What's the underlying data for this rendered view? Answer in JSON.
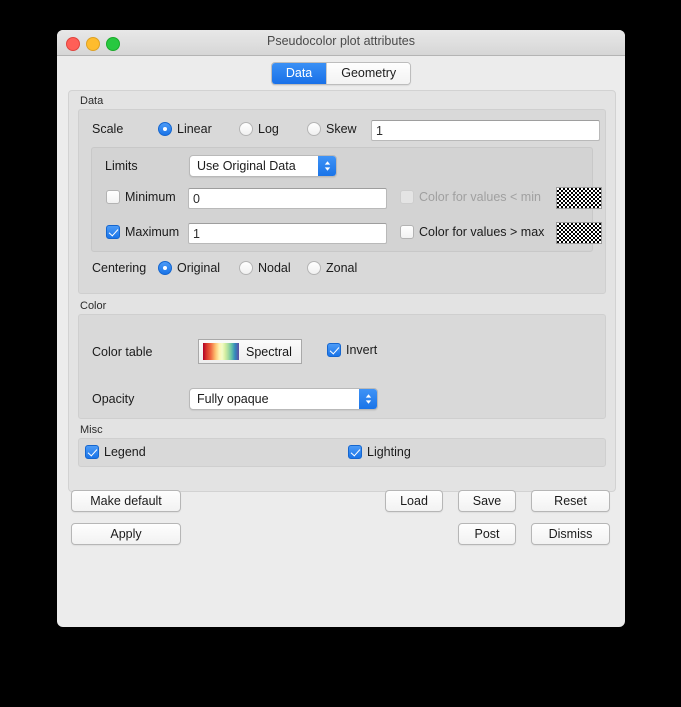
{
  "window": {
    "title": "Pseudocolor plot attributes",
    "controls": {
      "close": "close-button",
      "minimize": "minimize-button",
      "maximize": "maximize-button"
    }
  },
  "tabs": [
    {
      "label": "Data",
      "active": true
    },
    {
      "label": "Geometry",
      "active": false
    }
  ],
  "data_group": {
    "title": "Data",
    "scale": {
      "label": "Scale",
      "options": [
        {
          "label": "Linear",
          "selected": true
        },
        {
          "label": "Log",
          "selected": false
        },
        {
          "label": "Skew",
          "selected": false
        }
      ],
      "skew_value": "1"
    },
    "limits": {
      "label": "Limits",
      "selected": "Use Original Data",
      "minimum": {
        "label": "Minimum",
        "checked": false,
        "value": "0"
      },
      "maximum": {
        "label": "Maximum",
        "checked": true,
        "value": "1"
      },
      "color_below_min": {
        "label": "Color for values < min",
        "checked": false,
        "enabled": false
      },
      "color_above_max": {
        "label": "Color for values > max",
        "checked": false,
        "enabled": true
      }
    },
    "centering": {
      "label": "Centering",
      "options": [
        {
          "label": "Original",
          "selected": true
        },
        {
          "label": "Nodal",
          "selected": false
        },
        {
          "label": "Zonal",
          "selected": false
        }
      ]
    }
  },
  "color_group": {
    "title": "Color",
    "color_table": {
      "label": "Color table",
      "value": "Spectral",
      "invert": {
        "label": "Invert",
        "checked": true
      }
    },
    "opacity": {
      "label": "Opacity",
      "selected": "Fully opaque"
    }
  },
  "misc_group": {
    "title": "Misc",
    "legend": {
      "label": "Legend",
      "checked": true
    },
    "lighting": {
      "label": "Lighting",
      "checked": true
    }
  },
  "buttons": {
    "make_default": "Make default",
    "apply": "Apply",
    "load": "Load",
    "save": "Save",
    "reset": "Reset",
    "post": "Post",
    "dismiss": "Dismiss"
  },
  "colors": {
    "accent": "#1a74e8",
    "window_bg": "#ececec",
    "panel_bg": "#e3e3e3",
    "group_bg": "#d9d9d9"
  }
}
